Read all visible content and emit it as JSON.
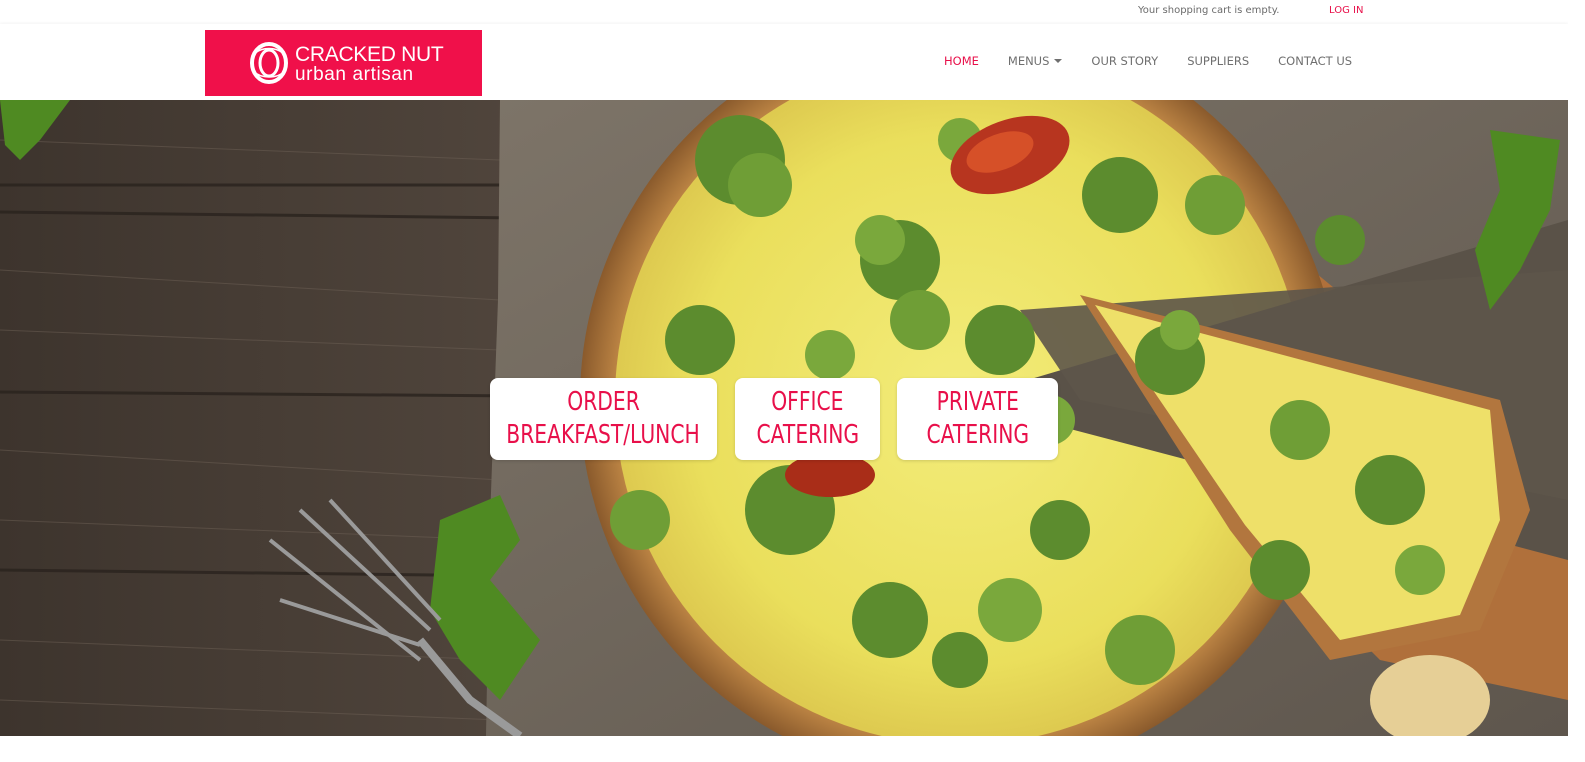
{
  "topbar": {
    "cart_status": "Your shopping cart is empty.",
    "login_label": "LOG IN"
  },
  "logo": {
    "line1": "CRACKED NUT",
    "line2": "urban artisan",
    "brand_color": "#f0104a"
  },
  "nav": {
    "items": [
      {
        "label": "HOME",
        "active": true
      },
      {
        "label": "MENUS",
        "has_dropdown": true
      },
      {
        "label": "OUR STORY"
      },
      {
        "label": "SUPPLIERS"
      },
      {
        "label": "CONTACT US"
      }
    ],
    "active_color": "#e8104a"
  },
  "hero": {
    "image": "quiche-on-wooden-table",
    "cta_buttons": [
      {
        "line1": "ORDER",
        "line2": "BREAKFAST/LUNCH"
      },
      {
        "line1": "OFFICE",
        "line2": "CATERING"
      },
      {
        "line1": "PRIVATE",
        "line2": "CATERING"
      }
    ]
  }
}
